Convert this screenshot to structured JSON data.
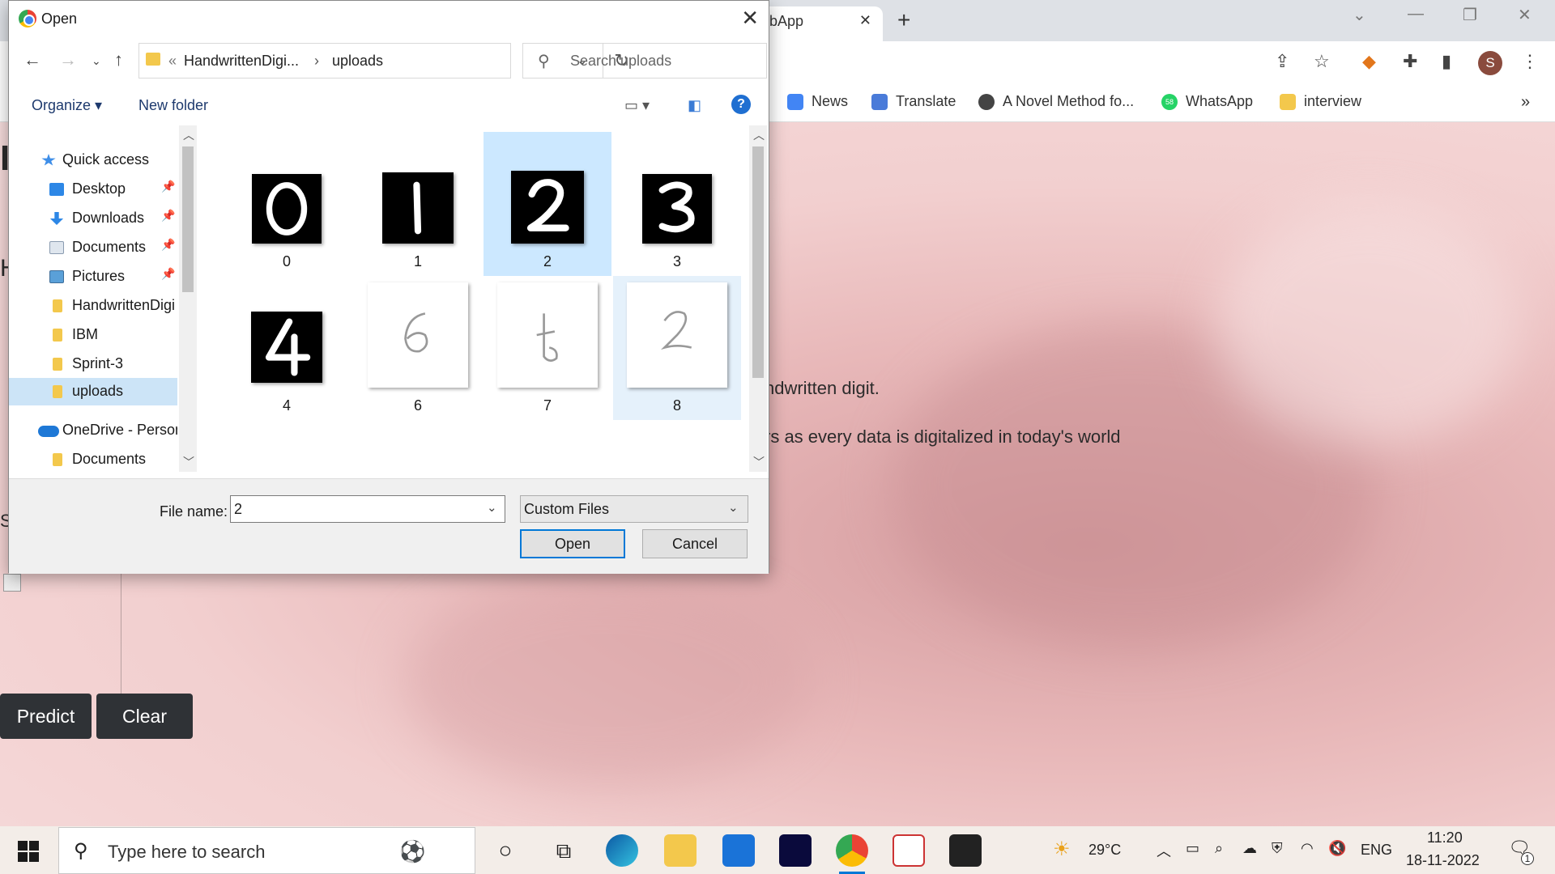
{
  "browser": {
    "tab_title": "bApp",
    "bookmarks": [
      {
        "label": "News",
        "icon": "google-news-icon"
      },
      {
        "label": "Translate",
        "icon": "google-translate-icon"
      },
      {
        "label": "A Novel Method fo...",
        "icon": "globe-icon"
      },
      {
        "label": "WhatsApp",
        "icon": "whatsapp-icon",
        "badge": "58"
      },
      {
        "label": "interview",
        "icon": "folder-icon"
      }
    ],
    "profile_initial": "S"
  },
  "page": {
    "line1": "ndwritten digit.",
    "line2": "rs as every data is digitalized in today's world",
    "edge_h1": "I",
    "edge_h2": "H",
    "edge_s": "S",
    "predict_label": "Predict",
    "clear_label": "Clear"
  },
  "dialog": {
    "title": "Open",
    "breadcrumb": {
      "prefix": "«",
      "parent": "HandwrittenDigi...",
      "separator": "›",
      "current": "uploads"
    },
    "search_placeholder": "Search uploads",
    "organize_label": "Organize ▾",
    "new_folder_label": "New folder",
    "help_label": "?",
    "nav_items": [
      {
        "label": "Quick access",
        "icon": "star-icon",
        "pinned": false
      },
      {
        "label": "Desktop",
        "icon": "desktop-icon",
        "pinned": true
      },
      {
        "label": "Downloads",
        "icon": "download-icon",
        "pinned": true
      },
      {
        "label": "Documents",
        "icon": "documents-icon",
        "pinned": true
      },
      {
        "label": "Pictures",
        "icon": "pictures-icon",
        "pinned": true
      },
      {
        "label": "HandwrittenDigi",
        "icon": "folder-icon",
        "pinned": false
      },
      {
        "label": "IBM",
        "icon": "folder-icon",
        "pinned": false
      },
      {
        "label": "Sprint-3",
        "icon": "folder-icon",
        "pinned": false
      },
      {
        "label": "uploads",
        "icon": "folder-icon",
        "pinned": false,
        "selected": true
      },
      {
        "label": "OneDrive - Person",
        "icon": "onedrive-icon",
        "pinned": false
      },
      {
        "label": "Documents",
        "icon": "folder-icon",
        "pinned": false
      }
    ],
    "files": [
      {
        "name": "0",
        "digit": "0"
      },
      {
        "name": "1",
        "digit": "1"
      },
      {
        "name": "2",
        "digit": "2",
        "selected": true
      },
      {
        "name": "3",
        "digit": "3"
      },
      {
        "name": "4",
        "digit": "4"
      },
      {
        "name": "6",
        "digit": "6"
      },
      {
        "name": "7",
        "digit": "7"
      },
      {
        "name": "8",
        "digit": "2",
        "hover": true
      }
    ],
    "file_name_label": "File name:",
    "file_name_value": "2",
    "file_type": "Custom Files",
    "open_label": "Open",
    "cancel_label": "Cancel"
  },
  "taskbar": {
    "search_placeholder": "Type here to search",
    "weather": "29°C",
    "language": "ENG",
    "time": "11:20",
    "date": "18-11-2022",
    "notification_count": "1"
  }
}
